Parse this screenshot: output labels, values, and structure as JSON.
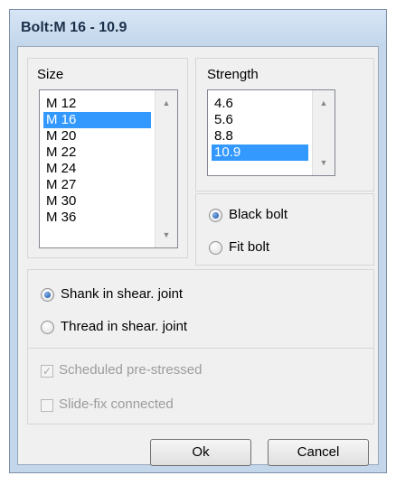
{
  "window": {
    "title": "Bolt:M 16 - 10.9"
  },
  "size": {
    "label": "Size",
    "items": [
      "M 12",
      "M 16",
      "M 20",
      "M 22",
      "M 24",
      "M 27",
      "M 30",
      "M 36"
    ],
    "selected": "M 16"
  },
  "strength": {
    "label": "Strength",
    "items": [
      "4.6",
      "5.6",
      "8.8",
      "10.9"
    ],
    "selected": "10.9"
  },
  "bolt_type": {
    "black": {
      "label": "Black bolt",
      "checked": true
    },
    "fit": {
      "label": "Fit bolt",
      "checked": false
    }
  },
  "joint": {
    "shank": {
      "label": "Shank in shear. joint",
      "checked": true
    },
    "thread": {
      "label": "Thread in shear. joint",
      "checked": false
    }
  },
  "options": {
    "prestressed": {
      "label": "Scheduled pre-stressed",
      "checked": true,
      "enabled": false
    },
    "slidefix": {
      "label": "Slide-fix connected",
      "checked": false,
      "enabled": false
    }
  },
  "buttons": {
    "ok": "Ok",
    "cancel": "Cancel"
  },
  "icons": {
    "scroll_up": "chevron-up-icon",
    "scroll_down": "chevron-down-icon"
  }
}
